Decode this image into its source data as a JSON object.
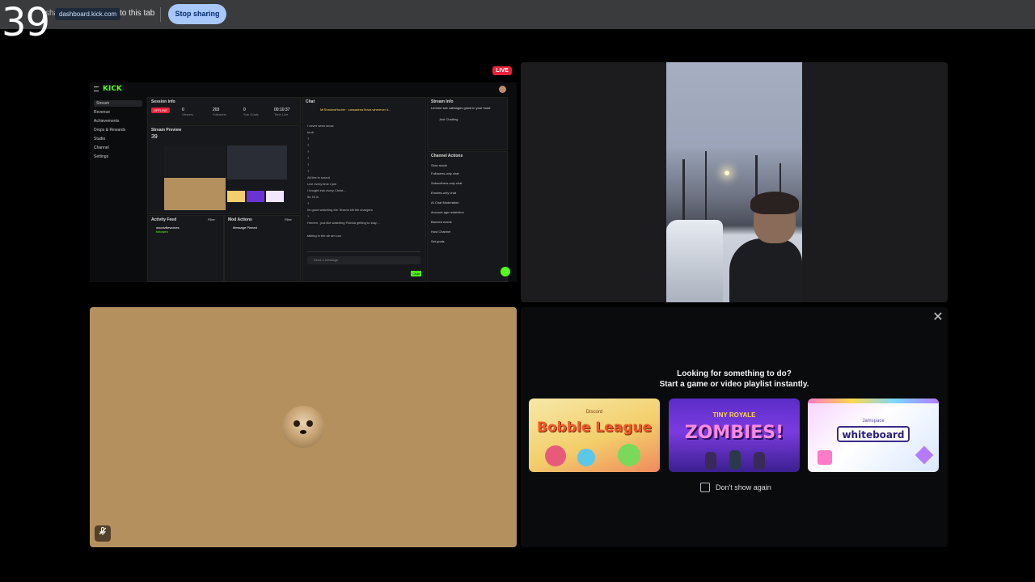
{
  "share_bar": {
    "counter": "39",
    "sharing_text": "sharing",
    "domain": "dashboard.kick.com",
    "to_tab_text": "to this tab",
    "stop_label": "Stop sharing"
  },
  "stream_tile": {
    "live_badge": "LIVE",
    "kick": {
      "logo": "KICK",
      "sidebar": [
        "Stream",
        "Revenue",
        "Achievements",
        "Drops & Rewards",
        "Studio",
        "Channel",
        "Settings"
      ],
      "session_title": "Session info",
      "offline": "OFFLINE",
      "stats": [
        {
          "value": "0",
          "label": "Viewers"
        },
        {
          "value": "203",
          "label": "Followers"
        },
        {
          "value": "0",
          "label": "Sub Goals"
        },
        {
          "value": "00:10:37",
          "label": "Time Live"
        }
      ],
      "preview_title": "Stream Preview",
      "preview_counter": "39",
      "activity_feed_title": "Activity Feed",
      "activity_user": "woodvillewolves",
      "activity_desc": "followed",
      "mod_actions_title": "Mod Actions",
      "mod_action": "Message Pinned",
      "filter_label": "Filter",
      "chat_title": "Chat",
      "chat_pinned": "MrShadowHunter · cassadrea flows wherever it...",
      "chat_lines": [
        "I never seen snow",
        "bruh",
        "?",
        "?",
        "?",
        "?",
        "?",
        "?",
        "All lies in sound",
        "Live every time i join",
        "I bought into every Christ…",
        "Its 78 in",
        "?",
        "Im good watching the Texans kill the chargers",
        "?",
        "Hmmm ; just like watching Florida getting to stay…",
        "talking in the air am cuz"
      ],
      "chat_placeholder": "Send a message",
      "chat_send": "Chat",
      "stream_info_title": "Stream Info",
      "stream_info_text": "Lemme see cabbages ghost in your hood",
      "category": "Just Chatting",
      "channel_actions_title": "Channel Actions",
      "channel_actions": [
        "Slow mode",
        "Followers-only chat",
        "Subscribers-only chat",
        "Emotes-only chat",
        "AI Chat Moderation",
        "Account age restriction",
        "Banned words",
        "Host Channel",
        "Set goals"
      ]
    }
  },
  "activity_tile": {
    "close_icon": "close-icon",
    "headline_1": "Looking for something to do?",
    "headline_2": "Start a game or video playlist instantly.",
    "cards": [
      {
        "title": "Bobble League",
        "sub": "Discord"
      },
      {
        "title": "ZOMBIES!",
        "sub": "TINY ROYALE"
      },
      {
        "title": "whiteboard",
        "sub": "Jamspace"
      }
    ],
    "dont_show": "Don't show again"
  },
  "avatar_tile": {
    "mute_icon": "mic-muted-icon"
  },
  "colors": {
    "accent": "#a8c7fa",
    "kick_green": "#53fc18",
    "live_red": "#e8223a",
    "avatar_bg": "#b5905f"
  }
}
